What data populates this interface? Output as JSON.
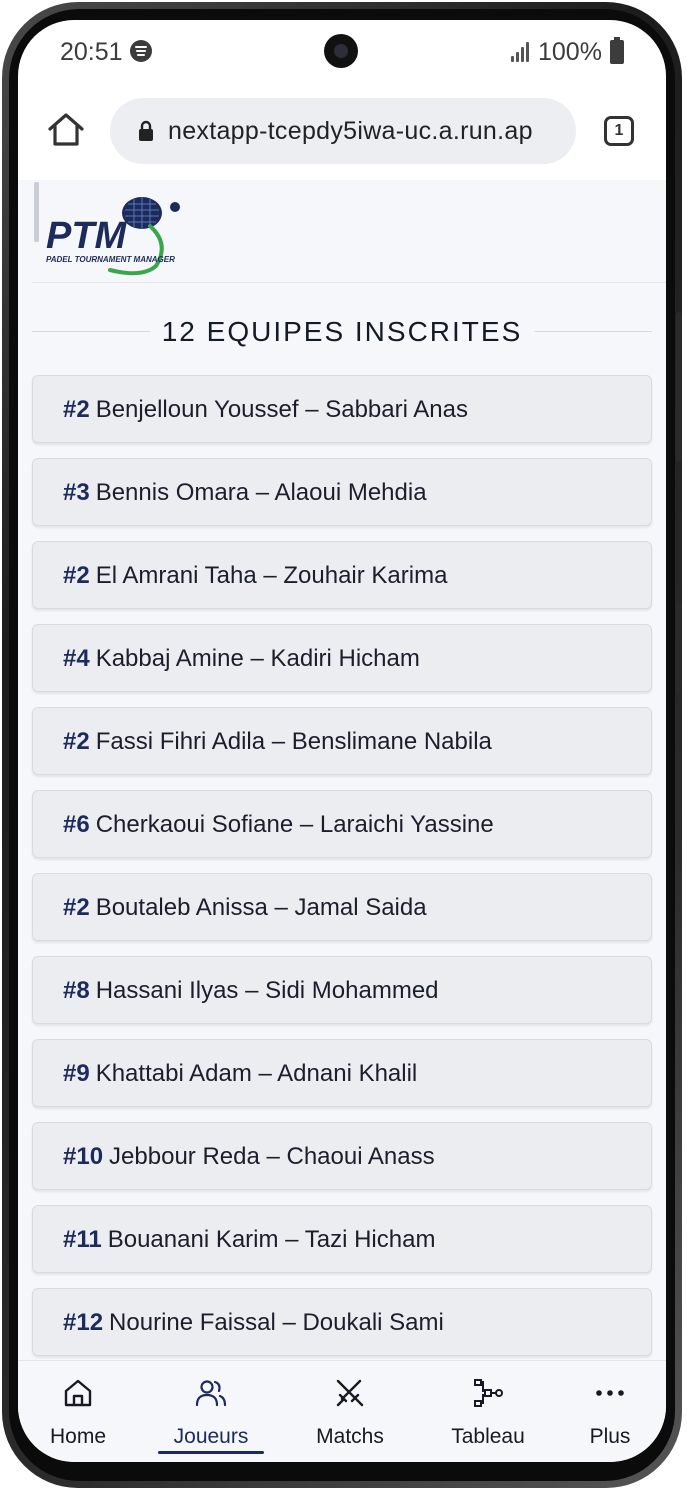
{
  "status_bar": {
    "time": "20:51",
    "battery": "100%",
    "icons": [
      "spotify-icon",
      "signal-icon",
      "battery-icon"
    ]
  },
  "browser": {
    "url": "nextapp-tcepdy5iwa-uc.a.run.ap",
    "tab_count": "1",
    "icons": [
      "home-icon",
      "lock-icon",
      "tabs-icon"
    ]
  },
  "header": {
    "logo_letters": "PTM",
    "logo_subtitle": "PADEL TOURNAMENT MANAGER"
  },
  "section": {
    "title": "12 EQUIPES INSCRITES"
  },
  "teams": [
    {
      "seed": "#2",
      "name": "Benjelloun Youssef – Sabbari Anas"
    },
    {
      "seed": "#3",
      "name": "Bennis Omara – Alaoui Mehdia"
    },
    {
      "seed": "#2",
      "name": "El Amrani Taha – Zouhair Karima"
    },
    {
      "seed": "#4",
      "name": "Kabbaj Amine – Kadiri Hicham"
    },
    {
      "seed": "#2",
      "name": "Fassi Fihri Adila – Benslimane Nabila"
    },
    {
      "seed": "#6",
      "name": "Cherkaoui Sofiane – Laraichi Yassine"
    },
    {
      "seed": "#2",
      "name": "Boutaleb Anissa – Jamal Saida"
    },
    {
      "seed": "#8",
      "name": "Hassani Ilyas – Sidi Mohammed"
    },
    {
      "seed": "#9",
      "name": "Khattabi Adam – Adnani Khalil"
    },
    {
      "seed": "#10",
      "name": "Jebbour Reda – Chaoui Anass"
    },
    {
      "seed": "#11",
      "name": "Bouanani Karim – Tazi Hicham"
    },
    {
      "seed": "#12",
      "name": "Nourine Faissal – Doukali Sami"
    }
  ],
  "nav": {
    "active": "Joueurs",
    "items": [
      {
        "label": "Home",
        "icon": "home-icon"
      },
      {
        "label": "Joueurs",
        "icon": "users-icon"
      },
      {
        "label": "Matchs",
        "icon": "crossed-swords-icon"
      },
      {
        "label": "Tableau",
        "icon": "bracket-icon"
      },
      {
        "label": "Plus",
        "icon": "more-icon"
      }
    ]
  },
  "colors": {
    "brand_navy": "#1c2a5c",
    "brand_green": "#3aa64a",
    "card_bg": "#ecedf1",
    "page_bg": "#f6f7fa"
  }
}
